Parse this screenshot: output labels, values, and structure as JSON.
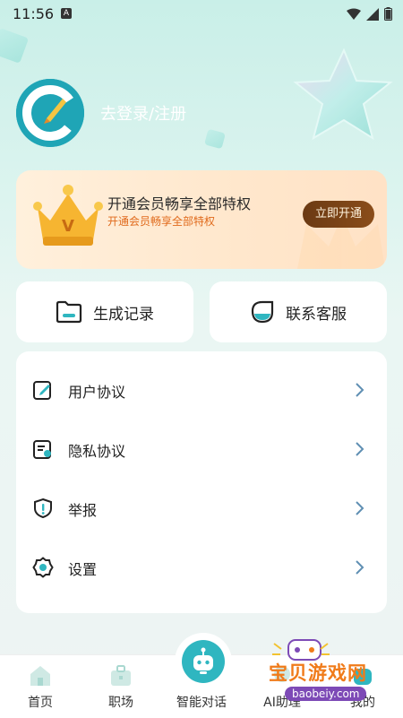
{
  "status_bar": {
    "time": "11:56",
    "a_badge": "A"
  },
  "profile": {
    "login_label": "去登录/注册"
  },
  "vip": {
    "title": "开通会员畅享全部特权",
    "subtitle": "开通会员畅享全部特权",
    "button_label": "立即开通",
    "crown_letter": "V"
  },
  "quick_actions": [
    {
      "label": "生成记录",
      "icon": "folder-icon"
    },
    {
      "label": "联系客服",
      "icon": "customer-service-icon"
    }
  ],
  "menu": [
    {
      "label": "用户协议",
      "icon": "edit-doc-icon"
    },
    {
      "label": "隐私协议",
      "icon": "privacy-doc-icon"
    },
    {
      "label": "举报",
      "icon": "shield-alert-icon"
    },
    {
      "label": "设置",
      "icon": "gear-icon"
    }
  ],
  "tabbar": [
    {
      "label": "首页",
      "icon": "home-icon"
    },
    {
      "label": "职场",
      "icon": "briefcase-icon"
    },
    {
      "label": "智能对话",
      "icon": "robot-icon"
    },
    {
      "label": "AI助理",
      "icon": "assistant-icon"
    },
    {
      "label": "我的",
      "icon": "profile-icon"
    }
  ],
  "watermark": {
    "title": "宝贝游戏网",
    "url": "baobeiy.com"
  },
  "colors": {
    "accent": "#2fb6c0",
    "vip_orange": "#e06a1c",
    "vip_button": "#6b3a13"
  }
}
